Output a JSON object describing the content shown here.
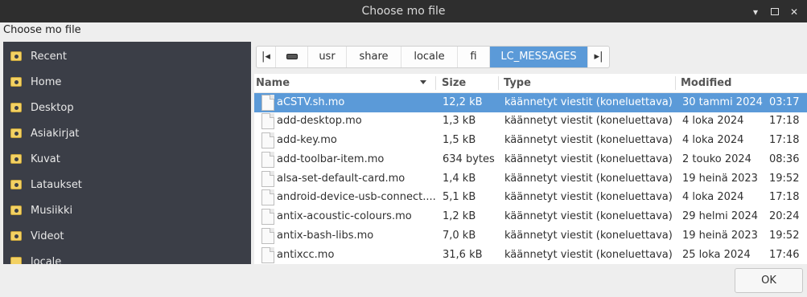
{
  "window": {
    "title": "Choose mo file"
  },
  "dialog": {
    "label": "Choose mo file"
  },
  "sidebar": {
    "items": [
      {
        "label": "Recent",
        "icon": "recent-folder-icon"
      },
      {
        "label": "Home",
        "icon": "home-folder-icon"
      },
      {
        "label": "Desktop",
        "icon": "desktop-folder-icon"
      },
      {
        "label": "Asiakirjat",
        "icon": "documents-folder-icon"
      },
      {
        "label": "Kuvat",
        "icon": "pictures-folder-icon"
      },
      {
        "label": "Lataukset",
        "icon": "downloads-folder-icon"
      },
      {
        "label": "Musiikki",
        "icon": "music-folder-icon"
      },
      {
        "label": "Videot",
        "icon": "videos-folder-icon"
      },
      {
        "label": "locale",
        "icon": "folder-icon"
      }
    ]
  },
  "pathbar": {
    "segments": [
      "usr",
      "share",
      "locale",
      "fi",
      "LC_MESSAGES"
    ]
  },
  "columns": {
    "name": "Name",
    "size": "Size",
    "type": "Type",
    "modified": "Modified"
  },
  "files": [
    {
      "name": "aCSTV.sh.mo",
      "size": "12,2 kB",
      "type": "käännetyt viestit (koneluettava)",
      "date": "30 tammi 2024",
      "time": "03:17"
    },
    {
      "name": "add-desktop.mo",
      "size": "1,3 kB",
      "type": "käännetyt viestit (koneluettava)",
      "date": "4 loka 2024",
      "time": "17:18"
    },
    {
      "name": "add-key.mo",
      "size": "1,5 kB",
      "type": "käännetyt viestit (koneluettava)",
      "date": "4 loka 2024",
      "time": "17:18"
    },
    {
      "name": "add-toolbar-item.mo",
      "size": "634 bytes",
      "type": "käännetyt viestit (koneluettava)",
      "date": "2 touko 2024",
      "time": "08:36"
    },
    {
      "name": "alsa-set-default-card.mo",
      "size": "1,4 kB",
      "type": "käännetyt viestit (koneluettava)",
      "date": "19 heinä 2023",
      "time": "19:52"
    },
    {
      "name": "android-device-usb-connect....",
      "size": "5,1 kB",
      "type": "käännetyt viestit (koneluettava)",
      "date": "4 loka 2024",
      "time": "17:18"
    },
    {
      "name": "antix-acoustic-colours.mo",
      "size": "1,2 kB",
      "type": "käännetyt viestit (koneluettava)",
      "date": "29 helmi 2024",
      "time": "20:24"
    },
    {
      "name": "antix-bash-libs.mo",
      "size": "7,0 kB",
      "type": "käännetyt viestit (koneluettava)",
      "date": "19 heinä 2023",
      "time": "19:52"
    },
    {
      "name": "antixcc.mo",
      "size": "31,6 kB",
      "type": "käännetyt viestit (koneluettava)",
      "date": "25 loka 2024",
      "time": "17:46"
    }
  ],
  "buttons": {
    "ok": "OK"
  }
}
